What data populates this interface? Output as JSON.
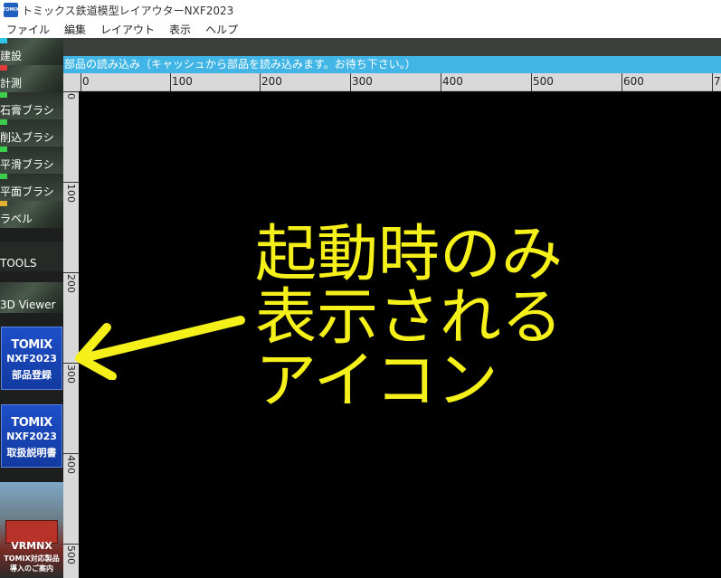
{
  "window": {
    "title": "トミックス鉄道模型レイアウターNXF2023",
    "icon_text": "TOMIX"
  },
  "menu": [
    "ファイル",
    "編集",
    "レイアウト",
    "表示",
    "ヘルプ"
  ],
  "status": {
    "text": "部品の読み込み（キャッシュから部品を読み込みます。お待ち下さい。）",
    "color": "#41b6e6"
  },
  "ruler": {
    "top_labels": [
      "0",
      "100",
      "200",
      "300",
      "400",
      "500",
      "600",
      "7"
    ],
    "left_labels": [
      "0",
      "100",
      "200",
      "300",
      "400",
      "500"
    ]
  },
  "sidebar": {
    "tools": [
      {
        "label": "建設",
        "swatch": "#2bc6e8"
      },
      {
        "label": "計測",
        "swatch": "#e03a3a"
      },
      {
        "label": "石膏ブラシ",
        "swatch": "#3ccf4e"
      },
      {
        "label": "削込ブラシ",
        "swatch": "#3ccf4e"
      },
      {
        "label": "平滑ブラシ",
        "swatch": "#3ccf4e"
      },
      {
        "label": "平面ブラシ",
        "swatch": "#3ccf4e"
      },
      {
        "label": "ラベル",
        "swatch": "#e0b030"
      },
      {
        "label": "TOOLS",
        "swatch": ""
      },
      {
        "label": "3D Viewer",
        "swatch": ""
      }
    ],
    "tomix_buttons": [
      {
        "brand": "TOMIX",
        "version": "NXF2023",
        "caption": "部品登録"
      },
      {
        "brand": "TOMIX",
        "version": "NXF2023",
        "caption": "取扱説明書"
      }
    ],
    "vrm": {
      "title": "VRMNX",
      "line1": "TOMIX対応製品",
      "line2": "導入のご案内"
    }
  },
  "annotation": {
    "lines": [
      "起動時のみ",
      "表示される",
      "アイコン"
    ],
    "color": "#f5f01a"
  }
}
